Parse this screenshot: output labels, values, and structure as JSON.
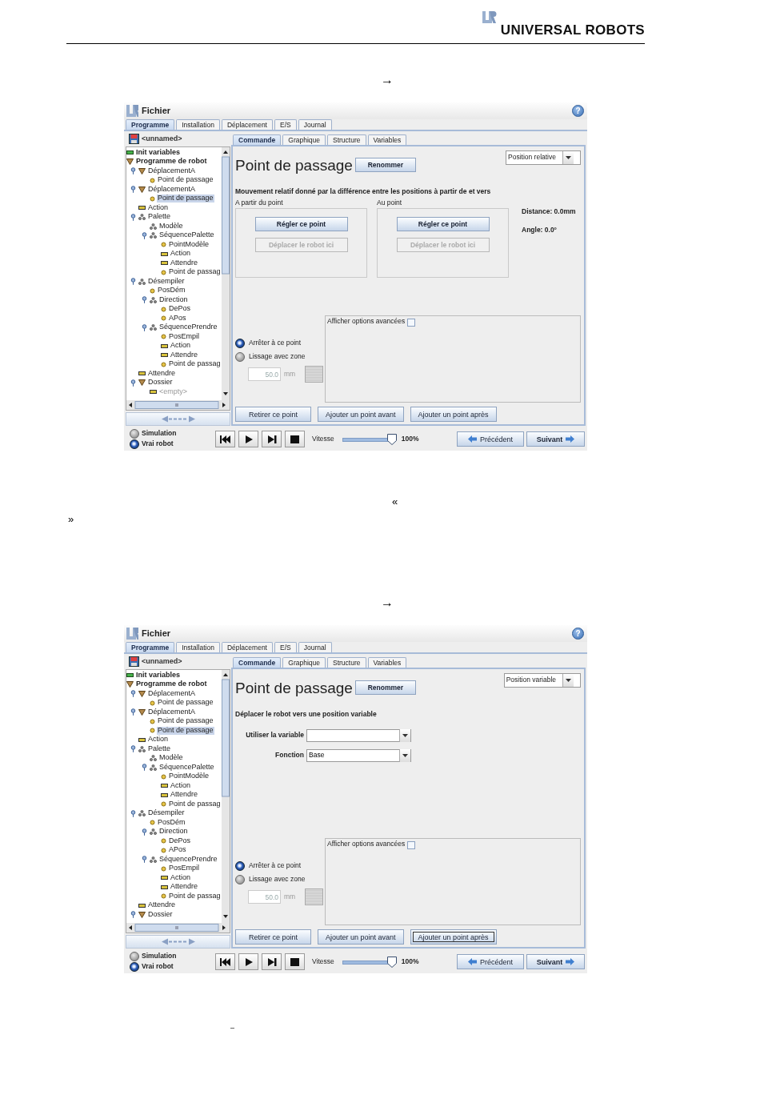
{
  "header": {
    "brand": "UNIVERSAL ROBOTS"
  },
  "sections": [
    {
      "kind": "mark",
      "text": "→"
    },
    {
      "kind": "screen",
      "menu": "Fichier",
      "help": "?",
      "tabs": [
        {
          "label": "Programme",
          "selected": true
        },
        {
          "label": "Installation",
          "selected": false
        },
        {
          "label": "Déplacement",
          "selected": false
        },
        {
          "label": "E/S",
          "selected": false
        },
        {
          "label": "Journal",
          "selected": false
        }
      ],
      "file": "<unnamed>",
      "tree": [
        {
          "label": "Init variables",
          "kind": "init",
          "selected": false
        },
        {
          "label": "Programme de robot",
          "kind": "folder",
          "selected": false,
          "children": [
            {
              "label": "DéplacementA",
              "kind": "folder",
              "selected": false,
              "expanded": true,
              "children": [
                {
                  "label": "Point de passage",
                  "kind": "waypoint",
                  "selected": false
                }
              ]
            },
            {
              "label": "DéplacementA",
              "kind": "folder",
              "selected": false,
              "expanded": true,
              "children": [
                {
                  "label": "Point de passage",
                  "kind": "waypoint",
                  "selected": true
                }
              ]
            },
            {
              "label": "Action",
              "kind": "command",
              "selected": false
            },
            {
              "label": "Palette",
              "kind": "pallet",
              "selected": false,
              "expanded": true,
              "children": [
                {
                  "label": "Modèle",
                  "kind": "pallet",
                  "selected": false
                },
                {
                  "label": "SéquencePalette",
                  "kind": "pallet",
                  "selected": false,
                  "expanded": true,
                  "children": [
                    {
                      "label": "PointModèle",
                      "kind": "waypoint",
                      "selected": false
                    },
                    {
                      "label": "Action",
                      "kind": "command",
                      "selected": false
                    },
                    {
                      "label": "Attendre",
                      "kind": "command",
                      "selected": false
                    },
                    {
                      "label": "Point de passag",
                      "kind": "waypoint",
                      "selected": false
                    }
                  ]
                }
              ]
            },
            {
              "label": "Désempiler",
              "kind": "pallet",
              "selected": false,
              "expanded": true,
              "children": [
                {
                  "label": "PosDém",
                  "kind": "waypoint",
                  "selected": false
                },
                {
                  "label": "Direction",
                  "kind": "pallet",
                  "selected": false,
                  "expanded": true,
                  "children": [
                    {
                      "label": "DePos",
                      "kind": "waypoint",
                      "selected": false
                    },
                    {
                      "label": "APos",
                      "kind": "waypoint",
                      "selected": false
                    }
                  ]
                },
                {
                  "label": "SéquencePrendre",
                  "kind": "pallet",
                  "selected": false,
                  "expanded": true,
                  "children": [
                    {
                      "label": "PosEmpil",
                      "kind": "waypoint",
                      "selected": false
                    },
                    {
                      "label": "Action",
                      "kind": "command",
                      "selected": false
                    },
                    {
                      "label": "Attendre",
                      "kind": "command",
                      "selected": false
                    },
                    {
                      "label": "Point de passag",
                      "kind": "waypoint",
                      "selected": false
                    }
                  ]
                }
              ]
            },
            {
              "label": "Attendre",
              "kind": "command",
              "selected": false
            },
            {
              "label": "Dossier",
              "kind": "folder",
              "selected": false,
              "expanded": true,
              "children": [
                {
                  "label": "<empty>",
                  "kind": "empty",
                  "selected": false
                }
              ]
            }
          ]
        }
      ],
      "subtabs": [
        {
          "label": "Commande",
          "selected": true
        },
        {
          "label": "Graphique",
          "selected": false
        },
        {
          "label": "Structure",
          "selected": false
        },
        {
          "label": "Variables",
          "selected": false
        }
      ],
      "title": "Point de passage",
      "rename": "Renommer",
      "mode": "Position relative",
      "description": "Mouvement relatif donné par la différence entre les positions à partir de et vers",
      "panel": {
        "kind": "relative",
        "groups": [
          {
            "title": "A partir du point",
            "set": "Régler ce point",
            "move": "Déplacer le robot ici",
            "move_disabled": true
          },
          {
            "title": "Au point",
            "set": "Régler ce point",
            "move": "Déplacer le robot ici",
            "move_disabled": true
          }
        ],
        "readouts": [
          "Distance: 0.0mm",
          "Angle: 0.0°"
        ]
      },
      "advanced": {
        "label": "Afficher options avancées",
        "checked": false
      },
      "stop_options": [
        {
          "label": "Arrêter à ce point",
          "selected": true
        },
        {
          "label": "Lissage avec zone",
          "selected": false
        }
      ],
      "blend": {
        "value": "50.0",
        "unit": "mm",
        "disabled": true
      },
      "actions": [
        {
          "label": "Retirer ce point",
          "focused": false
        },
        {
          "label": "Ajouter un point avant",
          "focused": false
        },
        {
          "label": "Ajouter un point après",
          "focused": false
        }
      ],
      "run_modes": [
        {
          "label": "Simulation",
          "selected": false
        },
        {
          "label": "Vrai robot",
          "selected": true
        }
      ],
      "speed": {
        "label": "Vitesse",
        "level": 1.0,
        "reading": "100%"
      },
      "nav": [
        "Précédent",
        "Suivant"
      ]
    },
    {
      "kind": "mark",
      "text": "«"
    },
    {
      "kind": "mark",
      "text": "»"
    },
    {
      "kind": "mark",
      "text": "→"
    },
    {
      "kind": "screen",
      "menu": "Fichier",
      "help": "?",
      "tabs": [
        {
          "label": "Programme",
          "selected": true
        },
        {
          "label": "Installation",
          "selected": false
        },
        {
          "label": "Déplacement",
          "selected": false
        },
        {
          "label": "E/S",
          "selected": false
        },
        {
          "label": "Journal",
          "selected": false
        }
      ],
      "file": "<unnamed>",
      "tree": [
        {
          "label": "Init variables",
          "kind": "init",
          "selected": false
        },
        {
          "label": "Programme de robot",
          "kind": "folder",
          "selected": false,
          "children": [
            {
              "label": "DéplacementA",
              "kind": "folder",
              "selected": false,
              "expanded": true,
              "children": [
                {
                  "label": "Point de passage",
                  "kind": "waypoint",
                  "selected": false
                }
              ]
            },
            {
              "label": "DéplacementA",
              "kind": "folder",
              "selected": false,
              "expanded": true,
              "children": [
                {
                  "label": "Point de passage",
                  "kind": "waypoint",
                  "selected": false
                },
                {
                  "label": "Point de passage",
                  "kind": "waypoint",
                  "selected": true
                }
              ]
            },
            {
              "label": "Action",
              "kind": "command",
              "selected": false
            },
            {
              "label": "Palette",
              "kind": "pallet",
              "selected": false,
              "expanded": true,
              "children": [
                {
                  "label": "Modèle",
                  "kind": "pallet",
                  "selected": false
                },
                {
                  "label": "SéquencePalette",
                  "kind": "pallet",
                  "selected": false,
                  "expanded": true,
                  "children": [
                    {
                      "label": "PointModèle",
                      "kind": "waypoint",
                      "selected": false
                    },
                    {
                      "label": "Action",
                      "kind": "command",
                      "selected": false
                    },
                    {
                      "label": "Attendre",
                      "kind": "command",
                      "selected": false
                    },
                    {
                      "label": "Point de passag",
                      "kind": "waypoint",
                      "selected": false
                    }
                  ]
                }
              ]
            },
            {
              "label": "Désempiler",
              "kind": "pallet",
              "selected": false,
              "expanded": true,
              "children": [
                {
                  "label": "PosDém",
                  "kind": "waypoint",
                  "selected": false
                },
                {
                  "label": "Direction",
                  "kind": "pallet",
                  "selected": false,
                  "expanded": true,
                  "children": [
                    {
                      "label": "DePos",
                      "kind": "waypoint",
                      "selected": false
                    },
                    {
                      "label": "APos",
                      "kind": "waypoint",
                      "selected": false
                    }
                  ]
                },
                {
                  "label": "SéquencePrendre",
                  "kind": "pallet",
                  "selected": false,
                  "expanded": true,
                  "children": [
                    {
                      "label": "PosEmpil",
                      "kind": "waypoint",
                      "selected": false
                    },
                    {
                      "label": "Action",
                      "kind": "command",
                      "selected": false
                    },
                    {
                      "label": "Attendre",
                      "kind": "command",
                      "selected": false
                    },
                    {
                      "label": "Point de passag",
                      "kind": "waypoint",
                      "selected": false
                    }
                  ]
                }
              ]
            },
            {
              "label": "Attendre",
              "kind": "command",
              "selected": false
            },
            {
              "label": "Dossier",
              "kind": "folder",
              "selected": false,
              "expanded": true
            }
          ]
        }
      ],
      "subtabs": [
        {
          "label": "Commande",
          "selected": true
        },
        {
          "label": "Graphique",
          "selected": false
        },
        {
          "label": "Structure",
          "selected": false
        },
        {
          "label": "Variables",
          "selected": false
        }
      ],
      "title": "Point de passage",
      "rename": "Renommer",
      "mode": "Position variable",
      "description": "Déplacer le robot vers une position variable",
      "panel": {
        "kind": "variable",
        "fields": [
          {
            "label": "Utiliser la variable"
          },
          {
            "label": "Fonction",
            "value": "Base"
          }
        ]
      },
      "advanced": {
        "label": "Afficher options avancées",
        "checked": false
      },
      "stop_options": [
        {
          "label": "Arrêter à ce point",
          "selected": true
        },
        {
          "label": "Lissage avec zone",
          "selected": false
        }
      ],
      "blend": {
        "value": "50.0",
        "unit": "mm",
        "disabled": true
      },
      "actions": [
        {
          "label": "Retirer ce point",
          "focused": false
        },
        {
          "label": "Ajouter un point avant",
          "focused": false
        },
        {
          "label": "Ajouter un point après",
          "focused": true
        }
      ],
      "run_modes": [
        {
          "label": "Simulation",
          "selected": false
        },
        {
          "label": "Vrai robot",
          "selected": true
        }
      ],
      "speed": {
        "label": "Vitesse",
        "level": 1.0,
        "reading": "100%"
      },
      "nav": [
        "Précédent",
        "Suivant"
      ]
    },
    {
      "kind": "mark",
      "text": "–"
    }
  ]
}
